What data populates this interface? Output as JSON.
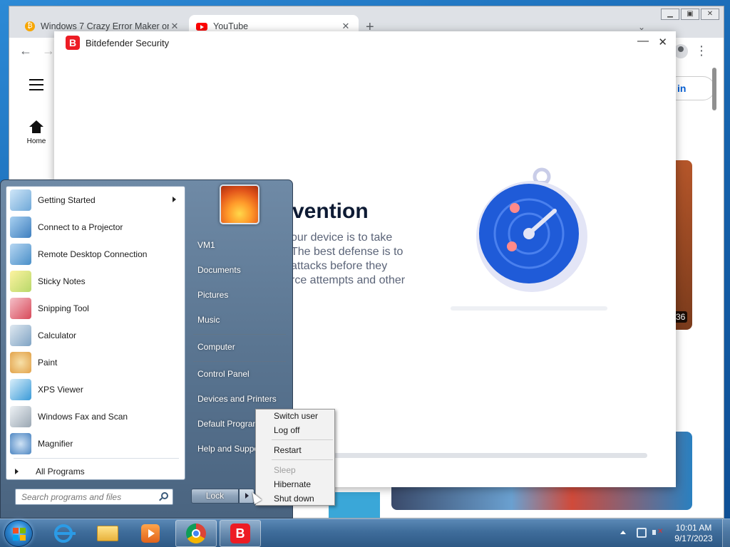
{
  "browser": {
    "tabs": [
      {
        "title": "Windows 7 Crazy Error Maker on",
        "favicon": "bitcoin-icon",
        "active": false
      },
      {
        "title": "YouTube",
        "favicon": "youtube-icon",
        "active": true
      }
    ],
    "new_tab_symbol": "+",
    "close_symbol": "✕"
  },
  "youtube": {
    "home_label": "Home",
    "signin_partial": "in",
    "video_duration_partial": "36"
  },
  "bitdefender": {
    "window_title": "Bitdefender Security",
    "logo_letter": "B",
    "heading_partial": "vention",
    "body_lines": "our device is to take\n The best defense is to\nattacks before they\nrce attempts and other",
    "accent_color": "#ed1c24"
  },
  "start_menu": {
    "programs": [
      {
        "label": "Getting Started",
        "icon": "getting-started-icon",
        "has_submenu": true,
        "color": "#6fa8d8"
      },
      {
        "label": "Connect to a Projector",
        "icon": "projector-icon",
        "has_submenu": false,
        "color": "#3f7fbf"
      },
      {
        "label": "Remote Desktop Connection",
        "icon": "remote-desktop-icon",
        "has_submenu": false,
        "color": "#4a8fc8"
      },
      {
        "label": "Sticky Notes",
        "icon": "sticky-notes-icon",
        "has_submenu": false,
        "color": "#e8d45a"
      },
      {
        "label": "Snipping Tool",
        "icon": "scissors-icon",
        "has_submenu": false,
        "color": "#d84a5a"
      },
      {
        "label": "Calculator",
        "icon": "calculator-icon",
        "has_submenu": false,
        "color": "#7fa3c4"
      },
      {
        "label": "Paint",
        "icon": "paint-palette-icon",
        "has_submenu": false,
        "color": "#e2a24a"
      },
      {
        "label": "XPS Viewer",
        "icon": "xps-viewer-icon",
        "has_submenu": false,
        "color": "#3a9ad8"
      },
      {
        "label": "Windows Fax and Scan",
        "icon": "fax-icon",
        "has_submenu": false,
        "color": "#9aa7b3"
      },
      {
        "label": "Magnifier",
        "icon": "magnifier-icon",
        "has_submenu": false,
        "color": "#4d86c2"
      }
    ],
    "all_programs": "All Programs",
    "search_placeholder": "Search programs and files",
    "user_avatar": "flower-avatar",
    "right_items": [
      "VM1",
      "Documents",
      "Pictures",
      "Music",
      "Computer",
      "Control Panel",
      "Devices and Printers",
      "Default Programs",
      "Help and Support"
    ],
    "lock_label": "Lock",
    "power_submenu": [
      {
        "label": "Switch user",
        "enabled": true
      },
      {
        "label": "Log off",
        "enabled": true
      },
      {
        "label": "Restart",
        "enabled": true
      },
      {
        "label": "Sleep",
        "enabled": false
      },
      {
        "label": "Hibernate",
        "enabled": true
      },
      {
        "label": "Shut down",
        "enabled": true
      }
    ]
  },
  "taskbar": {
    "pinned": [
      {
        "icon": "internet-explorer-icon"
      },
      {
        "icon": "file-explorer-icon"
      },
      {
        "icon": "media-player-icon"
      },
      {
        "icon": "chrome-icon"
      },
      {
        "icon": "bitdefender-icon",
        "letter": "B"
      }
    ],
    "time": "10:01 AM",
    "date": "9/17/2023"
  }
}
